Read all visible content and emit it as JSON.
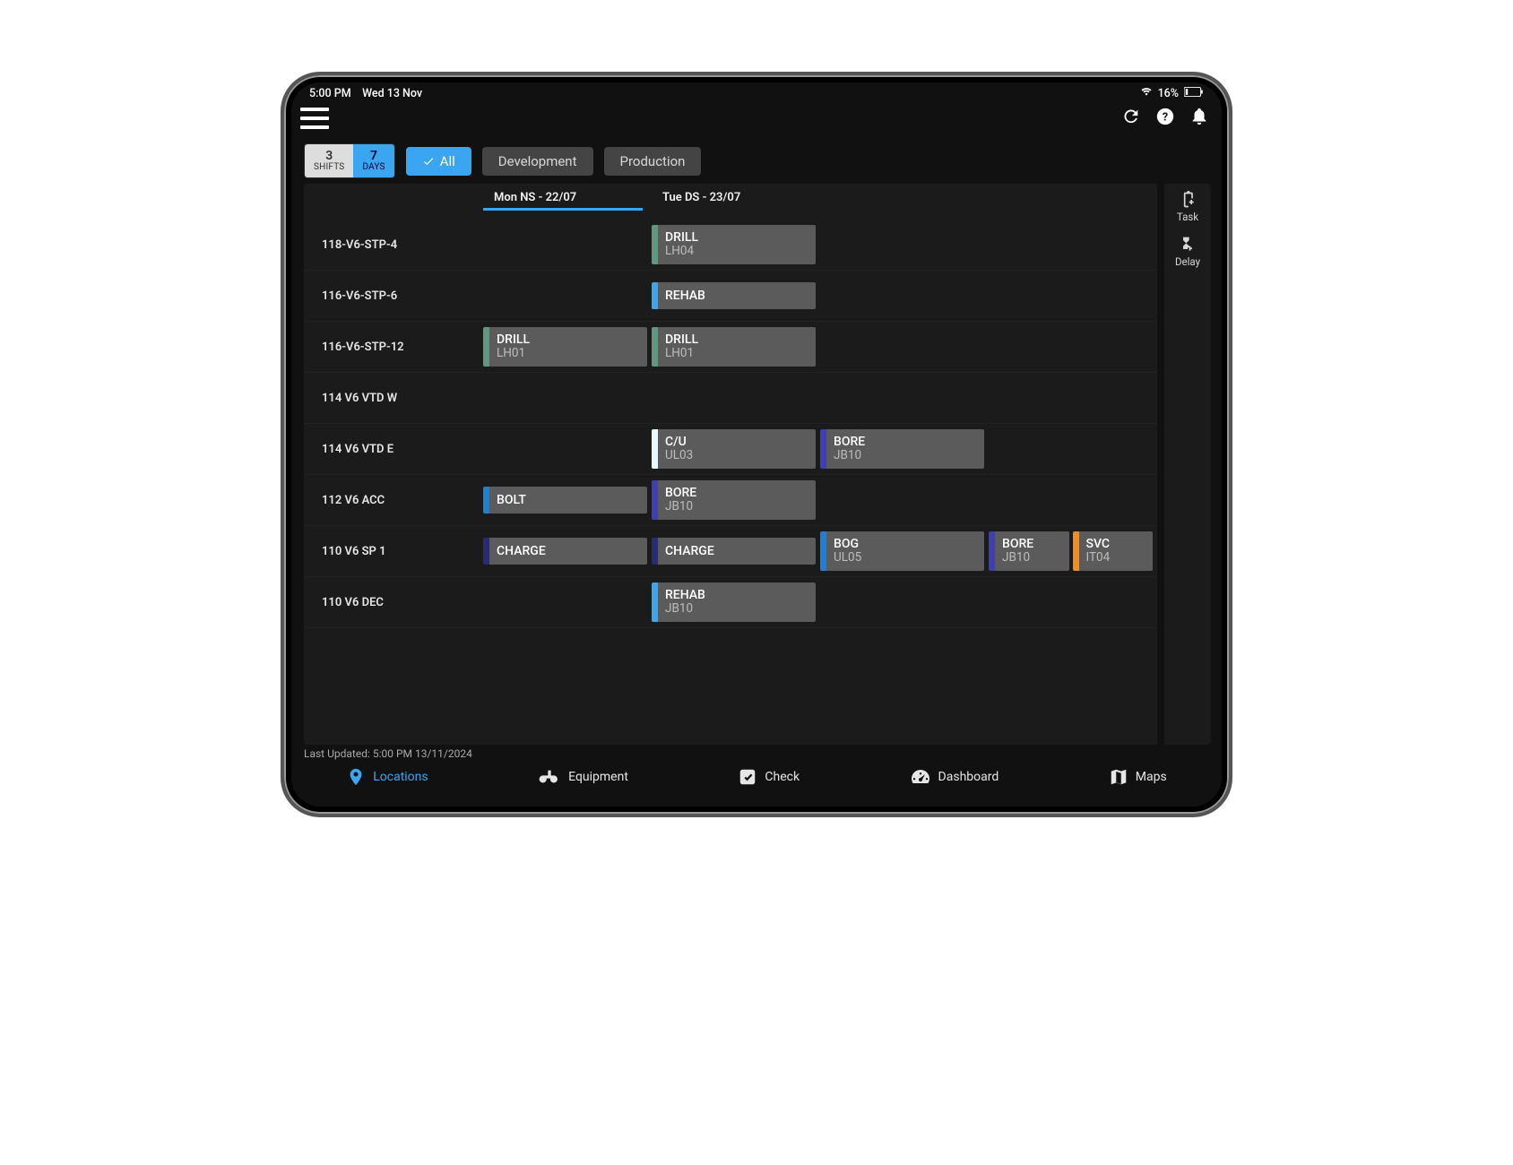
{
  "status": {
    "time": "5:00 PM",
    "date": "Wed 13 Nov",
    "battery": "16%"
  },
  "segments": {
    "shifts_n": "3",
    "shifts_l": "SHIFTS",
    "days_n": "7",
    "days_l": "DAYS"
  },
  "filters": {
    "all": "All",
    "dev": "Development",
    "prod": "Production"
  },
  "timeline": {
    "col1": "Mon NS - 22/07",
    "col2": "Tue DS - 23/07"
  },
  "locations": [
    "118-V6-STP-4",
    "116-V6-STP-6",
    "116-V6-STP-12",
    "114 V6 VTD W",
    "114 V6 VTD E",
    "112 V6 ACC",
    "110 V6 SP 1",
    "110 V6 DEC"
  ],
  "tasks": {
    "r0c1": {
      "title": "DRILL",
      "meta": "LH04",
      "color": "#5c9a7f"
    },
    "r1c1": {
      "title": "REHAB",
      "meta": "",
      "color": "#3aa6f2",
      "single": true
    },
    "r2c0": {
      "title": "DRILL",
      "meta": "LH01",
      "color": "#5c9a7f"
    },
    "r2c1": {
      "title": "DRILL",
      "meta": "LH01",
      "color": "#5c9a7f"
    },
    "r4c1": {
      "title": "C/U",
      "meta": "UL03",
      "color": "#e5faff"
    },
    "r4c2": {
      "title": "BORE",
      "meta": "JB10",
      "color": "#3c3fb5"
    },
    "r5c0": {
      "title": "BOLT",
      "meta": "",
      "color": "#1d7fd6",
      "single": true
    },
    "r5c1": {
      "title": "BORE",
      "meta": "JB10",
      "color": "#3c3fb5"
    },
    "r6c0": {
      "title": "CHARGE",
      "meta": "",
      "color": "#2a2b78",
      "single": true
    },
    "r6c1": {
      "title": "CHARGE",
      "meta": "",
      "color": "#2a2b78",
      "single": true
    },
    "r6c2": {
      "title": "BOG",
      "meta": "UL05",
      "color": "#1d7fd6"
    },
    "r6c3": {
      "title": "BORE",
      "meta": "JB10",
      "color": "#3c3fb5"
    },
    "r6c4": {
      "title": "SVC",
      "meta": "IT04",
      "color": "#f28c1d"
    },
    "r7c1": {
      "title": "REHAB",
      "meta": "JB10",
      "color": "#3aa6f2"
    }
  },
  "rail": {
    "task": "Task",
    "delay": "Delay"
  },
  "footer": "Last Updated: 5:00 PM 13/11/2024",
  "nav": {
    "loc": "Locations",
    "eq": "Equipment",
    "chk": "Check",
    "dash": "Dashboard",
    "map": "Maps"
  }
}
